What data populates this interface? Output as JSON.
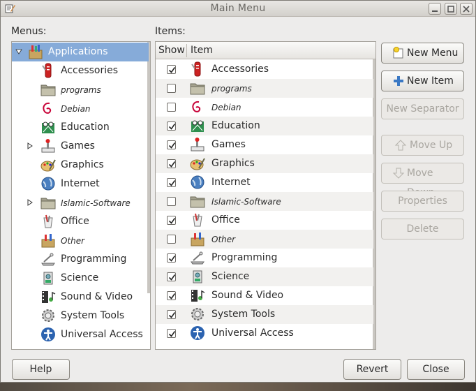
{
  "window": {
    "title": "Main Menu"
  },
  "menus": {
    "label": "Menus:",
    "tree": [
      {
        "label": "Applications",
        "icon": "applications-icon",
        "italic": false,
        "selected": true,
        "expander": "expanded"
      },
      {
        "label": "Accessories",
        "icon": "accessories-icon",
        "italic": false,
        "expander": "none"
      },
      {
        "label": "programs",
        "icon": "folder-icon",
        "italic": true,
        "expander": "none"
      },
      {
        "label": "Debian",
        "icon": "debian-icon",
        "italic": true,
        "expander": "none"
      },
      {
        "label": "Education",
        "icon": "education-icon",
        "italic": false,
        "expander": "none"
      },
      {
        "label": "Games",
        "icon": "games-icon",
        "italic": false,
        "expander": "collapsed"
      },
      {
        "label": "Graphics",
        "icon": "graphics-icon",
        "italic": false,
        "expander": "none"
      },
      {
        "label": "Internet",
        "icon": "internet-icon",
        "italic": false,
        "expander": "none"
      },
      {
        "label": "Islamic-Software",
        "icon": "folder-icon",
        "italic": true,
        "expander": "collapsed"
      },
      {
        "label": "Office",
        "icon": "office-icon",
        "italic": false,
        "expander": "none"
      },
      {
        "label": "Other",
        "icon": "other-icon",
        "italic": true,
        "expander": "none"
      },
      {
        "label": "Programming",
        "icon": "programming-icon",
        "italic": false,
        "expander": "none"
      },
      {
        "label": "Science",
        "icon": "science-icon",
        "italic": false,
        "expander": "none"
      },
      {
        "label": "Sound & Video",
        "icon": "sound-video-icon",
        "italic": false,
        "expander": "none"
      },
      {
        "label": "System Tools",
        "icon": "system-tools-icon",
        "italic": false,
        "expander": "none"
      },
      {
        "label": "Universal Access",
        "icon": "universal-access-icon",
        "italic": false,
        "expander": "none"
      }
    ]
  },
  "items": {
    "label": "Items:",
    "columns": {
      "show": "Show",
      "item": "Item"
    },
    "rows": [
      {
        "label": "Accessories",
        "icon": "accessories-icon",
        "shown": true,
        "italic": false
      },
      {
        "label": "programs",
        "icon": "folder-icon",
        "shown": false,
        "italic": true
      },
      {
        "label": "Debian",
        "icon": "debian-icon",
        "shown": false,
        "italic": true
      },
      {
        "label": "Education",
        "icon": "education-icon",
        "shown": true,
        "italic": false
      },
      {
        "label": "Games",
        "icon": "games-icon",
        "shown": true,
        "italic": false
      },
      {
        "label": "Graphics",
        "icon": "graphics-icon",
        "shown": true,
        "italic": false
      },
      {
        "label": "Internet",
        "icon": "internet-icon",
        "shown": true,
        "italic": false
      },
      {
        "label": "Islamic-Software",
        "icon": "folder-icon",
        "shown": false,
        "italic": true
      },
      {
        "label": "Office",
        "icon": "office-icon",
        "shown": true,
        "italic": false
      },
      {
        "label": "Other",
        "icon": "other-icon",
        "shown": false,
        "italic": true
      },
      {
        "label": "Programming",
        "icon": "programming-icon",
        "shown": true,
        "italic": false
      },
      {
        "label": "Science",
        "icon": "science-icon",
        "shown": true,
        "italic": false
      },
      {
        "label": "Sound & Video",
        "icon": "sound-video-icon",
        "shown": true,
        "italic": false
      },
      {
        "label": "System Tools",
        "icon": "system-tools-icon",
        "shown": true,
        "italic": false
      },
      {
        "label": "Universal Access",
        "icon": "universal-access-icon",
        "shown": true,
        "italic": false
      }
    ]
  },
  "buttons": {
    "new_menu": "New Menu",
    "new_item": "New Item",
    "new_separator": "New Separator",
    "move_up": "Move Up",
    "move_down": "Move Down",
    "properties": "Properties",
    "delete": "Delete",
    "help": "Help",
    "revert": "Revert",
    "close": "Close"
  },
  "colors": {
    "selection": "#86abd9",
    "window_bg": "#edeceb"
  }
}
